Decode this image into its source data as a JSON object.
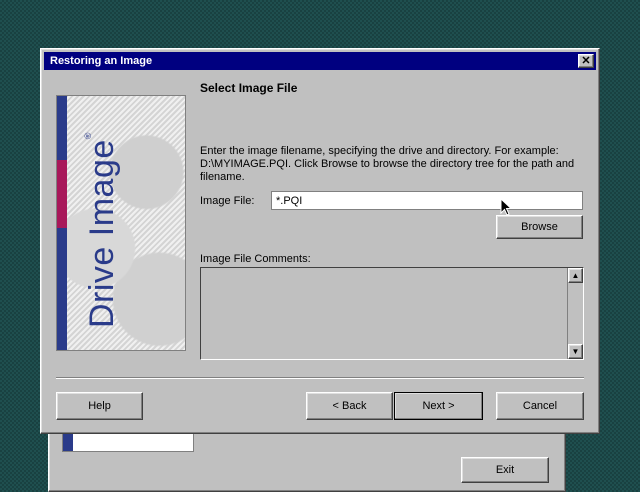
{
  "background_window": {
    "exit_label": "Exit"
  },
  "dialog": {
    "title": "Restoring an Image",
    "close_icon": "close-icon",
    "logo_text": "Drive Image",
    "logo_mark": "®",
    "heading": "Select Image File",
    "instructions": "Enter the image filename, specifying the drive and directory.  For example: D:\\MYIMAGE.PQI.  Click Browse to browse the directory tree for the path and filename.",
    "image_file_label": "Image File:",
    "image_file_value": "*.PQI",
    "browse_label": "Browse",
    "comments_label": "Image File Comments:",
    "comments_value": "",
    "buttons": {
      "help": "Help",
      "back": "< Back",
      "next": "Next >",
      "cancel": "Cancel"
    }
  },
  "colors": {
    "desktop": "#1f4f4f",
    "title_bar": "#000080",
    "dialog_face": "#c0c0c0",
    "logo_blue": "#2a3b8a",
    "logo_accent": "#a8185a"
  }
}
